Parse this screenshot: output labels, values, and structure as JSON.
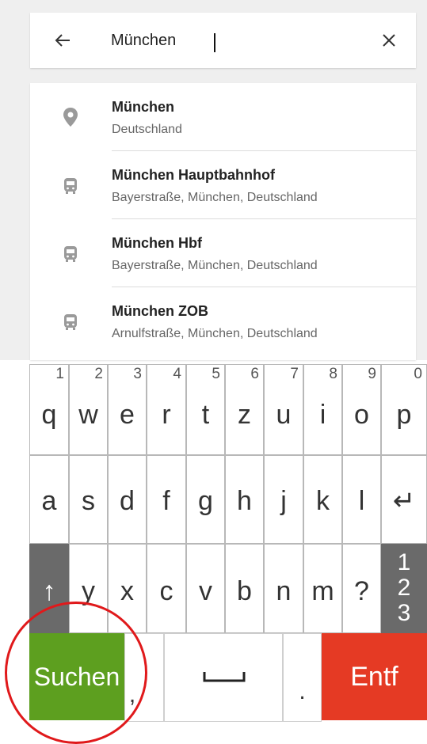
{
  "search": {
    "value": "München",
    "back_icon": "arrow-left-icon",
    "clear_icon": "close-icon"
  },
  "results": [
    {
      "icon": "location-pin-icon",
      "title_hl": "München",
      "title_rest": "",
      "subtitle": "Deutschland"
    },
    {
      "icon": "bus-icon",
      "title_hl": "München",
      "title_rest": " Hauptbahnhof",
      "subtitle": "Bayerstraße, München, Deutschland"
    },
    {
      "icon": "bus-icon",
      "title_hl": "München",
      "title_rest": " Hbf",
      "subtitle": "Bayerstraße, München, Deutschland"
    },
    {
      "icon": "bus-icon",
      "title_hl": "München",
      "title_rest": " ZOB",
      "subtitle": "Arnulfstraße, München, Deutschland"
    }
  ],
  "keyboard": {
    "row1": [
      {
        "main": "q",
        "num": "1"
      },
      {
        "main": "w",
        "num": "2"
      },
      {
        "main": "e",
        "num": "3"
      },
      {
        "main": "r",
        "num": "4"
      },
      {
        "main": "t",
        "num": "5"
      },
      {
        "main": "z",
        "num": "6"
      },
      {
        "main": "u",
        "num": "7"
      },
      {
        "main": "i",
        "num": "8"
      },
      {
        "main": "o",
        "num": "9"
      },
      {
        "main": "p",
        "num": "0"
      }
    ],
    "row2": [
      "a",
      "s",
      "d",
      "f",
      "g",
      "h",
      "j",
      "k",
      "l",
      "↵"
    ],
    "row3": [
      "↑",
      "y",
      "x",
      "c",
      "v",
      "b",
      "n",
      "m",
      "?"
    ],
    "numkey": [
      "1",
      "2",
      "3"
    ],
    "comma": ",",
    "space": "⎵",
    "period": ".",
    "search_label": "Suchen",
    "delete_label": "Entf"
  },
  "colors": {
    "search_key": "#5d9f1f",
    "delete_key": "#e53a24",
    "highlight_circle": "#e0191b"
  }
}
